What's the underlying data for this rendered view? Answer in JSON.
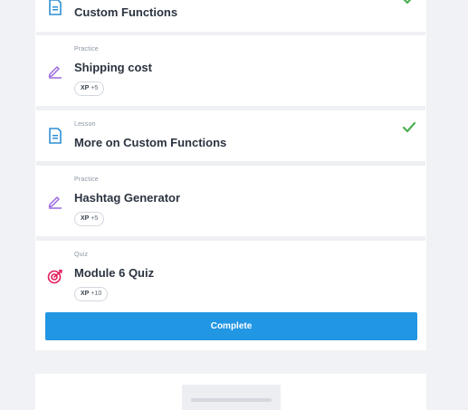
{
  "colors": {
    "lesson_icon": "#2e8fd6",
    "practice_icon": "#9b6ae0",
    "quiz_icon": "#e21d5a",
    "check": "#4caf50",
    "complete_button": "#2196e3"
  },
  "items": [
    {
      "type": "",
      "title": "Custom Functions",
      "icon": "document-icon",
      "completed": true
    },
    {
      "type": "Practice",
      "title": "Shipping cost",
      "icon": "pencil-icon",
      "xp_label": "XP",
      "xp_value": "+5"
    },
    {
      "type": "Lesson",
      "title": "More on Custom Functions",
      "icon": "document-icon",
      "completed": true
    },
    {
      "type": "Practice",
      "title": "Hashtag Generator",
      "icon": "pencil-icon",
      "xp_label": "XP",
      "xp_value": "+5"
    },
    {
      "type": "Quiz",
      "title": "Module 6 Quiz",
      "icon": "target-icon",
      "xp_label": "XP",
      "xp_value": "+10"
    }
  ],
  "complete_button": {
    "label": "Complete"
  }
}
